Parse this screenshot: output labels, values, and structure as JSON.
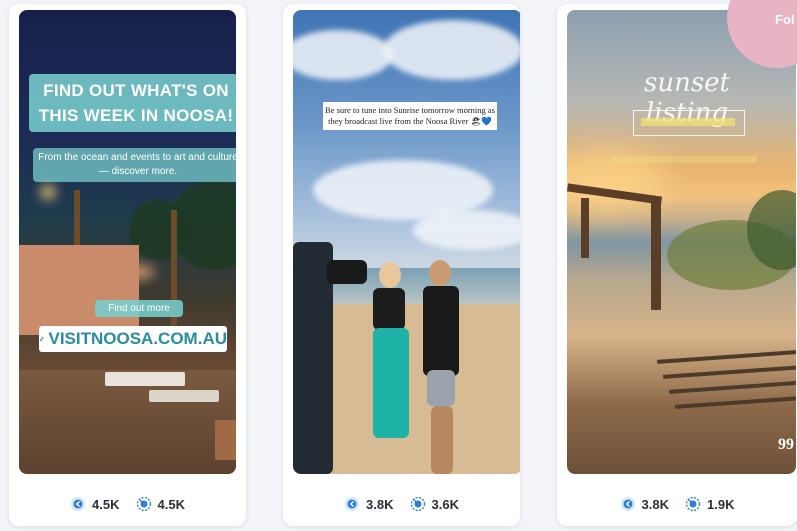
{
  "badge": {
    "text": "Fol"
  },
  "cards": [
    {
      "story": {
        "headline": "FIND OUT WHAT'S ON THIS WEEK IN NOOSA!",
        "subline": "From the ocean and events to art and culture — discover more.",
        "cta": "Find out more",
        "link_icon": "link-icon",
        "url": "VISITNOOSA.COM.AU"
      },
      "stats": [
        {
          "icon": "views-icon",
          "value": "4.5K"
        },
        {
          "icon": "reach-icon",
          "value": "4.5K"
        }
      ]
    },
    {
      "story": {
        "caption": "Be sure to tune into Sunrise tomorrow morning as they broadcast live from the Noosa River 🏖💙"
      },
      "stats": [
        {
          "icon": "views-icon",
          "value": "3.8K"
        },
        {
          "icon": "reach-icon",
          "value": "3.6K"
        }
      ]
    },
    {
      "story": {
        "script_title": "sunset listing",
        "corner_number": "99"
      },
      "stats": [
        {
          "icon": "views-icon",
          "value": "3.8K"
        },
        {
          "icon": "reach-icon",
          "value": "1.9K"
        }
      ]
    }
  ],
  "colors": {
    "accent": "#2f7fd8",
    "teal_overlay": "#78cdcd",
    "badge": "#e8b3c3"
  }
}
